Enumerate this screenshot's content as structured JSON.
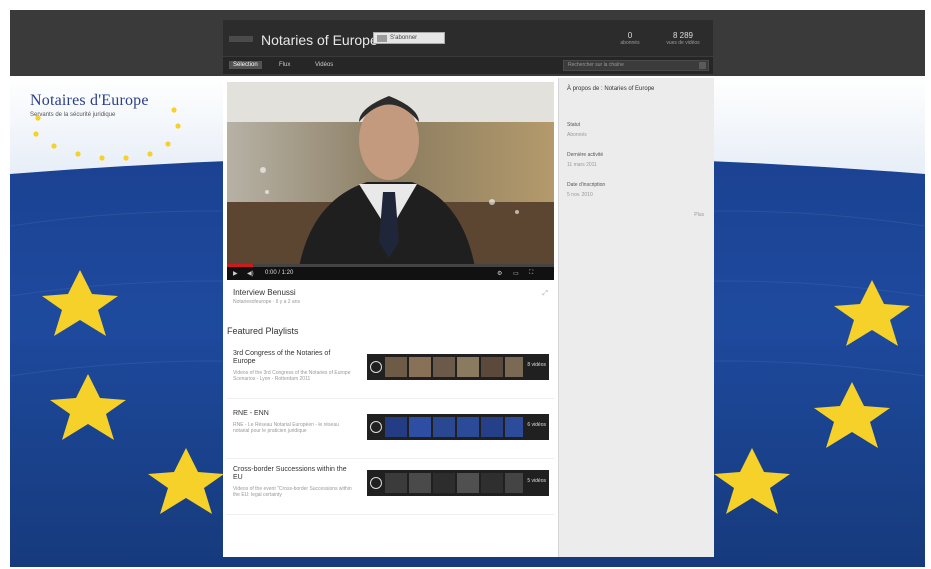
{
  "window": {
    "title": "Notaries of Europe"
  },
  "header": {
    "channel_title": "Notaries of Europe",
    "subscribe_label": "S'abonner",
    "stats": [
      {
        "value": "0",
        "label": "abonnés"
      },
      {
        "value": "8 289",
        "label": "vues de vidéos"
      }
    ]
  },
  "nav": {
    "tabs": [
      {
        "label": "Sélection"
      },
      {
        "label": "Flux"
      },
      {
        "label": "Vidéos"
      }
    ],
    "search_placeholder": "Rechercher sur la chaîne"
  },
  "video": {
    "time": "0:00 / 1:20",
    "title": "Interview Benussi",
    "meta": "Notariesofeurope  ·  Il y a 2 ans",
    "progress": 0.08
  },
  "featured": {
    "heading": "Featured Playlists",
    "playlists": [
      {
        "title": "3rd Congress of the Notaries of Europe",
        "desc": "Videos of the 3rd Congress of the Notaries of Europe Scenarios - Lyon - Rotterdam 2011",
        "count": "8 vidéos"
      },
      {
        "title": "RNE - ENN",
        "desc": "RNE - Le Réseau Notarial Européen - le réseau notarial pour le praticien juridique",
        "count": "6 vidéos"
      },
      {
        "title": "Cross-border Successions within the EU",
        "desc": "Videos of the event \"Cross-border Successions within the EU: legal certainty",
        "count": "5 vidéos"
      }
    ]
  },
  "sidebar": {
    "title": "À propos de : Notaries of Europe",
    "fields": [
      {
        "label": "Statut",
        "value": "Abonnés"
      },
      {
        "label": "Dernière activité",
        "value": "11 mars 2011"
      },
      {
        "label": "Date d'inscription",
        "value": "5 nov. 2010"
      }
    ],
    "more": "Plus"
  },
  "logo": {
    "title": "Notaires d'Europe",
    "subtitle": "Servants de la sécurité juridique"
  },
  "colors": {
    "flag_blue": "#1e4a9e",
    "star_yellow": "#f5d12a",
    "topbar": "#3a3a3a"
  }
}
